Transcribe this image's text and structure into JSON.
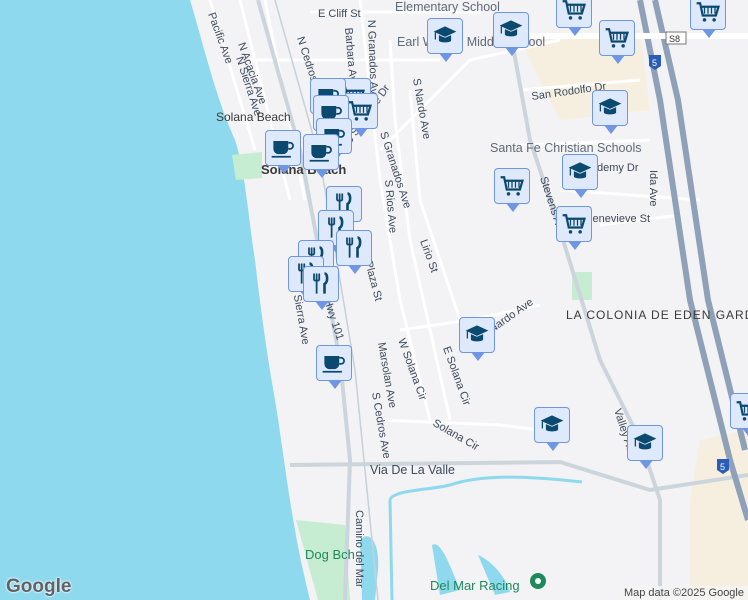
{
  "map": {
    "streets": [
      "E Cliff St",
      "Pacific Ave",
      "N Acacia Ave",
      "N Sierra Ave",
      "N Cedros Ave",
      "Barbara Ave",
      "N Granados Ave",
      "S Santa Fe Dr",
      "S Granados Ave",
      "S Nardo Ave",
      "San Rodolfo Dr",
      "Stevens Ave",
      "Ida Ave",
      "Genevieve St",
      "Lirio St",
      "Nardo Ave",
      "W Solana Cir",
      "E Solana Cir",
      "Solana Cir",
      "Marsolan Ave",
      "S Cedros Ave",
      "S Sierra Ave",
      "Hwy 101",
      "Valley Ave",
      "Via De La Valle",
      "Academy Dr",
      "Camino del Mar",
      "S Rios Ave",
      "Plaza St"
    ],
    "places": [
      "Solana Beach",
      "Solana Beach",
      "Elementary School",
      "Earl Warren Middle School",
      "Santa Fe Christian Schools",
      "LA COLONIA DE EDEN GARDENS",
      "Dog Bch",
      "Del Mar Racing"
    ],
    "highway_shields": [
      "5",
      "5",
      "S8"
    ],
    "markers": [
      "school",
      "school",
      "school",
      "school",
      "school",
      "school",
      "school",
      "grocery",
      "grocery",
      "grocery",
      "grocery",
      "grocery",
      "grocery",
      "grocery",
      "grocery",
      "coffee",
      "coffee",
      "coffee",
      "coffee",
      "coffee",
      "coffee",
      "restaurant",
      "restaurant",
      "restaurant",
      "restaurant",
      "restaurant",
      "restaurant"
    ],
    "colors": {
      "water": "#8ed9ee",
      "land": "#f3f2f4",
      "park": "#c6ecd2",
      "marker_bg": "#dfe9fc",
      "marker_border": "#6f96e2",
      "icon": "#0b4a6e"
    }
  },
  "footer": {
    "logo": "Google",
    "attribution": "Map data ©2025 Google"
  }
}
